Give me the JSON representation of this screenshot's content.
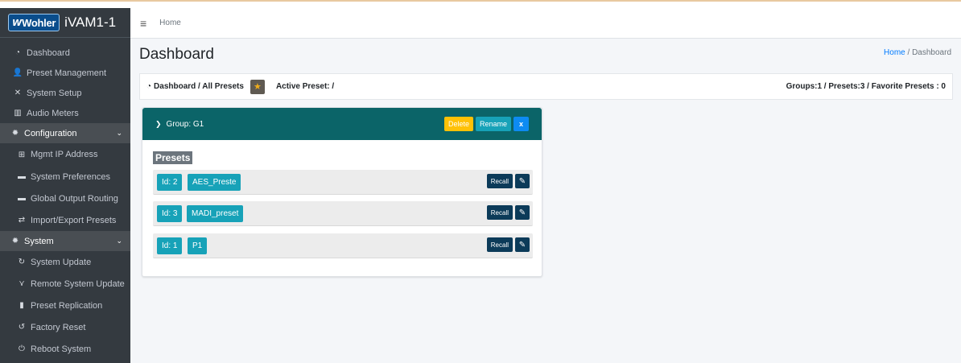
{
  "brand": {
    "logo_mark": "W",
    "logo_text": "Wohler",
    "product": "iVAM1-1"
  },
  "header": {
    "menu_icon": "hamburger-icon",
    "home_label": "Home"
  },
  "sidebar": {
    "items": [
      {
        "label": "Dashboard",
        "icon": "tachometer-icon"
      },
      {
        "label": "Preset Management",
        "icon": "user-edit-icon"
      },
      {
        "label": "System Setup",
        "icon": "tools-icon"
      },
      {
        "label": "Audio Meters",
        "icon": "chart-icon"
      }
    ],
    "config_section": {
      "label": "Configuration",
      "icon": "gear-icon"
    },
    "config_items": [
      {
        "label": "Mgmt IP Address",
        "icon": "network-icon"
      },
      {
        "label": "System Preferences",
        "icon": "keyboard-icon"
      },
      {
        "label": "Global Output Routing",
        "icon": "routing-icon"
      },
      {
        "label": "Import/Export Presets",
        "icon": "exchange-icon"
      }
    ],
    "system_section": {
      "label": "System",
      "icon": "gears-icon"
    },
    "system_items": [
      {
        "label": "System Update",
        "icon": "sync-icon"
      },
      {
        "label": "Remote System Update",
        "icon": "satellite-icon"
      },
      {
        "label": "Preset Replication",
        "icon": "copy-icon"
      },
      {
        "label": "Factory Reset",
        "icon": "undo-icon"
      },
      {
        "label": "Reboot System",
        "icon": "power-icon"
      }
    ]
  },
  "page": {
    "title": "Dashboard",
    "breadcrumb": {
      "home": "Home",
      "separator": "/",
      "current": "Dashboard"
    }
  },
  "infobar": {
    "path": "Dashboard / All Presets",
    "active_preset": "Active Preset: /",
    "counts": "Groups:1 / Presets:3 / Favorite Presets : 0"
  },
  "group": {
    "title": "Group: G1",
    "delete_label": "Delete",
    "rename_label": "Rename",
    "close_label": "x",
    "presets_heading": "Presets",
    "presets": [
      {
        "id": "Id: 2",
        "name": "AES_Preste",
        "recall": "Recall"
      },
      {
        "id": "Id: 3",
        "name": "MADI_preset",
        "recall": "Recall"
      },
      {
        "id": "Id: 1",
        "name": "P1",
        "recall": "Recall"
      }
    ]
  },
  "colors": {
    "sidebar_bg": "#343a40",
    "group_header": "#0b6468",
    "teal_tag": "#17a2b8",
    "recall_btn": "#0c3b59",
    "delete_btn": "#ffc107"
  }
}
